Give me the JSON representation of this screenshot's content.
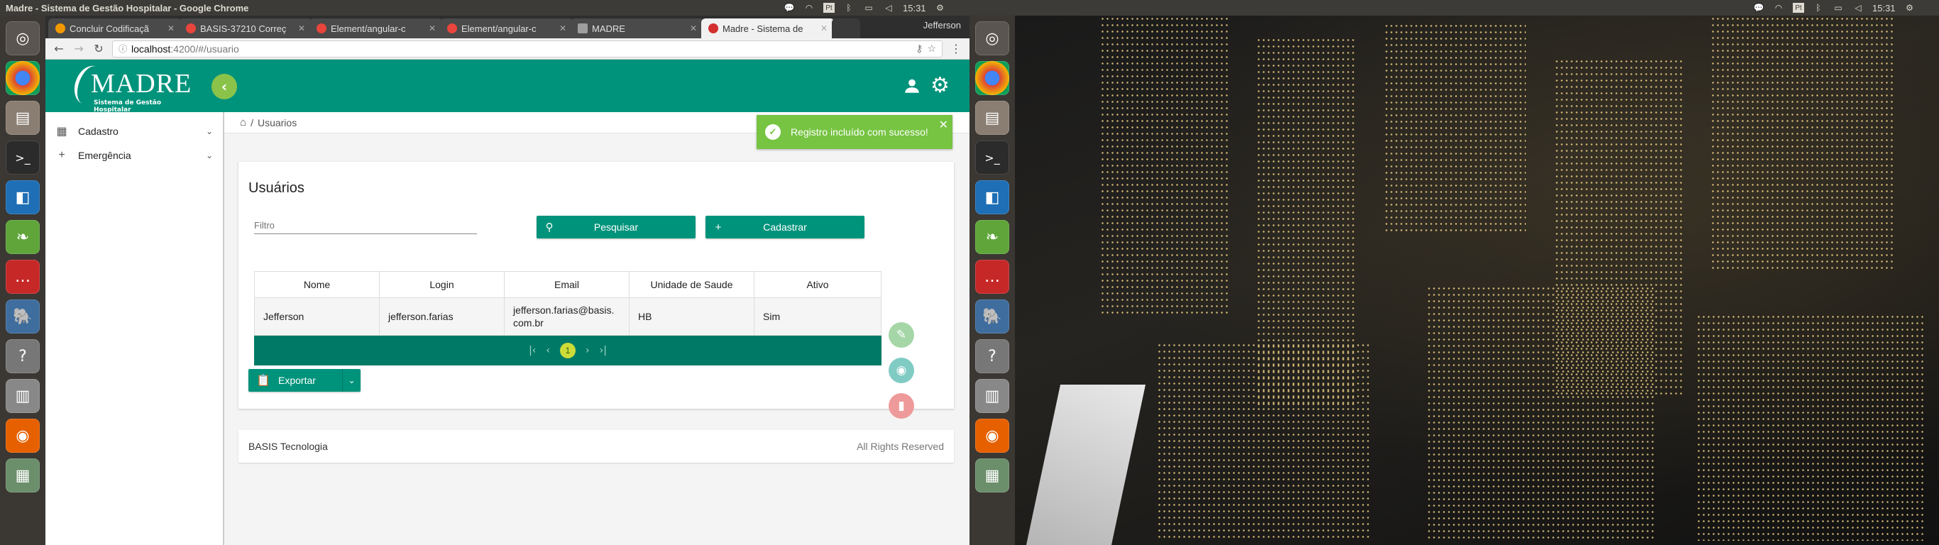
{
  "os": {
    "window_title": "Madre - Sistema de Gestão Hospitalar - Google Chrome",
    "clock": "15:31",
    "right_clock": "15:31",
    "tray_icons": [
      "chat-icon",
      "wifi-icon",
      "keyboard-layout-icon",
      "bluetooth-icon",
      "battery-icon",
      "sound-icon",
      "settings-icon"
    ],
    "keyboard_layout": "Pt",
    "launcher_icons": [
      "ubuntu-icon",
      "chrome-icon",
      "files-icon",
      "terminal-icon",
      "vscode-icon",
      "spring-icon",
      "chat-icon",
      "postgres-icon",
      "help-icon",
      "printer-icon",
      "firefox-icon",
      "app-icon",
      "app-icon",
      "app-icon"
    ]
  },
  "browser": {
    "tabs": [
      {
        "label": "Concluir Codificaçã",
        "favicon": "#f29900",
        "active": false
      },
      {
        "label": "BASIS-37210 Correç",
        "favicon": "#e8453c",
        "active": false
      },
      {
        "label": "Element/angular-c",
        "favicon": "#e8453c",
        "active": false
      },
      {
        "label": "Element/angular-c",
        "favicon": "#e8453c",
        "active": false
      },
      {
        "label": "MADRE",
        "favicon": "#9e9e9e",
        "active": false
      },
      {
        "label": "Madre - Sistema de",
        "favicon": "#d32f2f",
        "active": true
      }
    ],
    "profile": "Jefferson",
    "url_host": "localhost",
    "url_path": ":4200/#/usuario"
  },
  "app": {
    "logo_text": "MADRE",
    "logo_subtitle": "Sistema de Gestão Hospitalar",
    "sidebar": [
      {
        "label": "Cadastro",
        "icon": "grid-icon"
      },
      {
        "label": "Emergência",
        "icon": "plus-icon"
      }
    ],
    "breadcrumb": {
      "current": "Usuarios",
      "separator": "/"
    },
    "page_title": "Usuários",
    "filter_placeholder": "Filtro",
    "search_button": "Pesquisar",
    "create_button": "Cadastrar",
    "table": {
      "headers": [
        "Nome",
        "Login",
        "Email",
        "Unidade de Saude",
        "Ativo"
      ],
      "rows": [
        [
          "Jefferson",
          "jefferson.farias",
          "jefferson.farias@basis.\ncom.br",
          "HB",
          "Sim"
        ]
      ]
    },
    "pagination": {
      "current_page": "1"
    },
    "export_button": "Exportar",
    "footer_left": "BASIS Tecnologia",
    "footer_right": "All Rights Reserved",
    "toast": "Registro incluído com sucesso!",
    "colors": {
      "primary": "#00937b",
      "dark": "#007a66",
      "accent": "#8bc34a",
      "toast": "#76c442"
    }
  }
}
